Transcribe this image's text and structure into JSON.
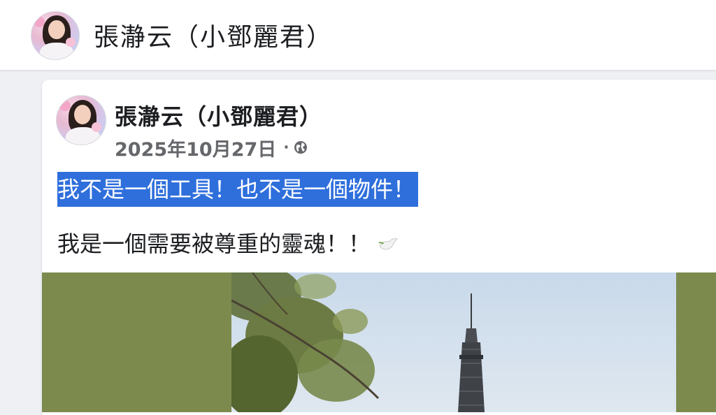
{
  "header": {
    "page_name": "張瀞云（小鄧麗君）",
    "avatar_icon": "profile-photo-icon"
  },
  "post": {
    "author": "張瀞云（小鄧麗君）",
    "date": "2025年10月27日",
    "separator": "·",
    "privacy_icon": "globe-icon",
    "text_line_1": "我不是一個工具！也不是一個物件！",
    "text_line_2": "我是一個需要被尊重的靈魂！！",
    "emoji_icon": "dove-icon",
    "photo_icon": "eiffel-tower-photo"
  },
  "colors": {
    "highlight": "#2f6fdc",
    "photo_border": "#7c8a4e",
    "text": "#1c1e21",
    "meta": "#65676b"
  }
}
